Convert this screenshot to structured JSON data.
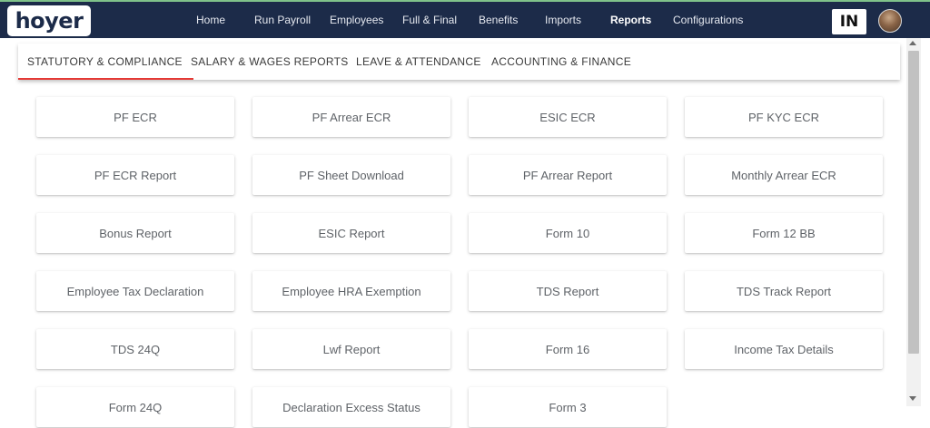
{
  "brand": {
    "logo_text": "hoyer"
  },
  "nav": {
    "items": [
      "Home",
      "Run Payroll",
      "Employees",
      "Full & Final",
      "Benefits",
      "Imports",
      "Reports",
      "Configurations"
    ],
    "active": "Reports"
  },
  "header": {
    "country_code": "IN"
  },
  "tabs": {
    "items": [
      "STATUTORY & COMPLIANCE",
      "SALARY & WAGES REPORTS",
      "LEAVE & ATTENDANCE",
      "ACCOUNTING & FINANCE"
    ],
    "active": "STATUTORY & COMPLIANCE"
  },
  "reports": [
    "PF ECR",
    "PF Arrear ECR",
    "ESIC ECR",
    "PF KYC ECR",
    "PF ECR Report",
    "PF Sheet Download",
    "PF Arrear Report",
    "Monthly Arrear ECR",
    "Bonus Report",
    "ESIC Report",
    "Form 10",
    "Form 12 BB",
    "Employee Tax Declaration",
    "Employee HRA Exemption",
    "TDS Report",
    "TDS Track Report",
    "TDS 24Q",
    "Lwf Report",
    "Form 16",
    "Income Tax Details",
    "Form 24Q",
    "Declaration Excess Status",
    "Form 3"
  ],
  "colors": {
    "topbar_bg": "#1c2b49",
    "tab_active_underline": "#e53935",
    "card_text": "#5f6368"
  }
}
